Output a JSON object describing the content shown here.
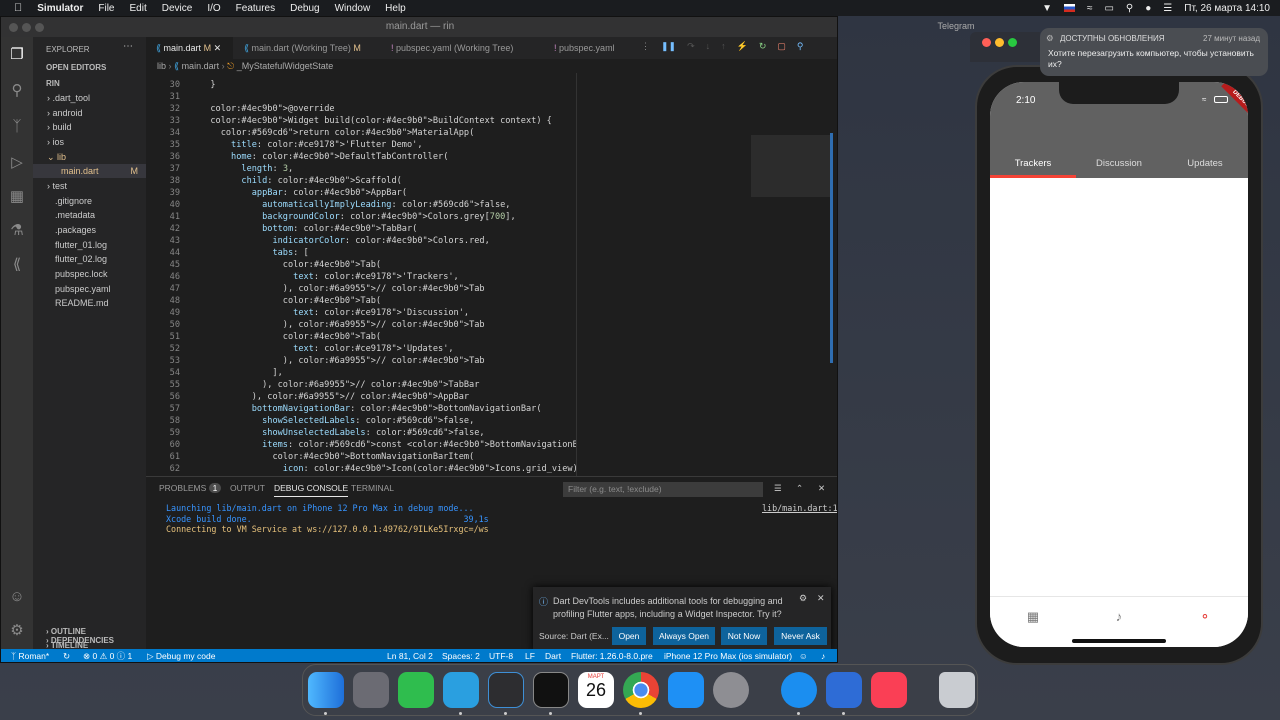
{
  "menubar": {
    "apple": "",
    "app_name": "Simulator",
    "items": [
      "File",
      "Edit",
      "Device",
      "I/O",
      "Features",
      "Debug",
      "Window",
      "Help"
    ],
    "datetime": "Пт, 26 марта  14:10"
  },
  "vscode": {
    "window_title": "main.dart — rin",
    "explorer_label": "EXPLORER",
    "open_editors_label": "OPEN EDITORS",
    "project_label": "RIN",
    "tree": [
      {
        "label": ".dart_tool",
        "type": "folder"
      },
      {
        "label": "android",
        "type": "folder"
      },
      {
        "label": "build",
        "type": "folder"
      },
      {
        "label": "ios",
        "type": "folder"
      },
      {
        "label": "lib",
        "type": "folder-open"
      },
      {
        "label": "main.dart",
        "type": "file",
        "badge": "M"
      },
      {
        "label": "test",
        "type": "folder"
      },
      {
        "label": ".gitignore",
        "type": "file"
      },
      {
        "label": ".metadata",
        "type": "file"
      },
      {
        "label": ".packages",
        "type": "file"
      },
      {
        "label": "flutter_01.log",
        "type": "file"
      },
      {
        "label": "flutter_02.log",
        "type": "file"
      },
      {
        "label": "pubspec.lock",
        "type": "file"
      },
      {
        "label": "pubspec.yaml",
        "type": "file"
      },
      {
        "label": "README.md",
        "type": "file"
      }
    ],
    "outline_label": "OUTLINE",
    "timeline_label": "TIMELINE",
    "dependencies_label": "DEPENDENCIES",
    "tabs": [
      {
        "label": "main.dart",
        "badge": "M",
        "active": true
      },
      {
        "label": "main.dart (Working Tree)",
        "badge": "M",
        "active": false
      },
      {
        "label": "pubspec.yaml (Working Tree)",
        "badge": "",
        "active": false
      },
      {
        "label": "pubspec.yaml",
        "badge": "",
        "active": false
      }
    ],
    "breadcrumb": [
      "lib",
      "main.dart",
      "_MyStatefulWidgetState"
    ],
    "code_lines": [
      {
        "n": "30",
        "t": "  }"
      },
      {
        "n": "31",
        "t": ""
      },
      {
        "n": "32",
        "t": "  @override"
      },
      {
        "n": "33",
        "t": "  Widget build(BuildContext context) {"
      },
      {
        "n": "34",
        "t": "    return MaterialApp("
      },
      {
        "n": "35",
        "t": "      title: 'Flutter Demo',"
      },
      {
        "n": "36",
        "t": "      home: DefaultTabController("
      },
      {
        "n": "37",
        "t": "        length: 3,"
      },
      {
        "n": "38",
        "t": "        child: Scaffold("
      },
      {
        "n": "39",
        "t": "          appBar: AppBar("
      },
      {
        "n": "40",
        "t": "            automaticallyImplyLeading: false,"
      },
      {
        "n": "41",
        "t": "            backgroundColor: Colors.grey[700],"
      },
      {
        "n": "42",
        "t": "            bottom: TabBar("
      },
      {
        "n": "43",
        "t": "              indicatorColor: Colors.red,"
      },
      {
        "n": "44",
        "t": "              tabs: ["
      },
      {
        "n": "45",
        "t": "                Tab("
      },
      {
        "n": "46",
        "t": "                  text: 'Trackers',"
      },
      {
        "n": "47",
        "t": "                ), // Tab"
      },
      {
        "n": "48",
        "t": "                Tab("
      },
      {
        "n": "49",
        "t": "                  text: 'Discussion',"
      },
      {
        "n": "50",
        "t": "                ), // Tab"
      },
      {
        "n": "51",
        "t": "                Tab("
      },
      {
        "n": "52",
        "t": "                  text: 'Updates',"
      },
      {
        "n": "53",
        "t": "                ), // Tab"
      },
      {
        "n": "54",
        "t": "              ],"
      },
      {
        "n": "55",
        "t": "            ), // TabBar"
      },
      {
        "n": "56",
        "t": "          ), // AppBar"
      },
      {
        "n": "57",
        "t": "          bottomNavigationBar: BottomNavigationBar("
      },
      {
        "n": "58",
        "t": "            showSelectedLabels: false,"
      },
      {
        "n": "59",
        "t": "            showUnselectedLabels: false,"
      },
      {
        "n": "60",
        "t": "            items: const <BottomNavigationBarItem>["
      },
      {
        "n": "61",
        "t": "              BottomNavigationBarItem("
      },
      {
        "n": "62",
        "t": "                icon: Icon(Icons.grid_view),"
      }
    ],
    "panel": {
      "tabs": [
        "PROBLEMS",
        "OUTPUT",
        "DEBUG CONSOLE",
        "TERMINAL"
      ],
      "problems_count": "1",
      "filter_placeholder": "Filter (e.g. text, !exclude)",
      "console": [
        "Launching lib/main.dart on iPhone 12 Pro Max in debug mode...",
        "Xcode build done.                                          39,1s",
        "Connecting to VM Service at ws://127.0.0.1:49762/9ILKe5Irxgc=/ws"
      ],
      "source_link": "lib/main.dart:1"
    },
    "notification": {
      "text": "Dart DevTools includes additional tools for debugging and profiling Flutter apps, including a Widget Inspector. Try it?",
      "source": "Source: Dart (Ex...",
      "buttons": [
        "Open",
        "Always Open",
        "Not Now",
        "Never Ask"
      ]
    },
    "status": {
      "branch": "Roman*",
      "errors": "0",
      "warnings": "0",
      "info": "1",
      "debug": "Debug my code",
      "position": "Ln 81, Col 2",
      "spaces": "Spaces: 2",
      "encoding": "UTF-8",
      "eol": "LF",
      "language": "Dart",
      "flutter": "Flutter: 1.26.0-8.0.pre",
      "device": "iPhone 12 Pro Max (ios simulator)"
    }
  },
  "simulator": {
    "time": "2:10",
    "debug_ribbon": "DEBUG",
    "tabs": [
      "Trackers",
      "Discussion",
      "Updates"
    ],
    "selected_tab": 0,
    "colors": {
      "appbar": "#616161",
      "indicator": "#f44336"
    },
    "bottom_nav": [
      "grid-view-icon",
      "bell-icon",
      "people-icon"
    ]
  },
  "telegram": {
    "title": "Telegram"
  },
  "banner": {
    "title": "ДОСТУПНЫ ОБНОВЛЕНИЯ",
    "time": "27 минут назад",
    "body": "Хотите перезагрузить компьютер, чтобы установить их?"
  },
  "dock": {
    "calendar_month": "МАРТ",
    "calendar_day": "26"
  }
}
